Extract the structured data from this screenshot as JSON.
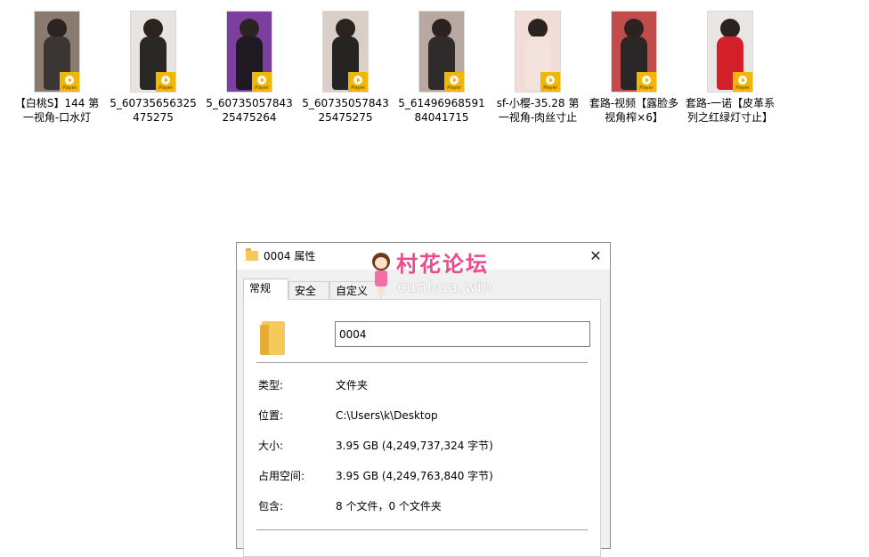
{
  "files": [
    {
      "name": "【白桃S】144 第一视角-口水灯",
      "badge": "Player"
    },
    {
      "name": "5_60735656325475275",
      "badge": "Player"
    },
    {
      "name": "5_6073505784325475264",
      "badge": "Player"
    },
    {
      "name": "5_6073505784325475275",
      "badge": "Player"
    },
    {
      "name": "5_6149696859184041715",
      "badge": "Player"
    },
    {
      "name": "sf-小樱-35.28 第一视角-肉丝寸止",
      "badge": "Player"
    },
    {
      "name": "套路-视频【露脸多视角榨×6】",
      "badge": "Player"
    },
    {
      "name": "套路-一诺【皮革系列之红绿灯寸止】",
      "badge": "Player"
    }
  ],
  "dialog": {
    "title": "0004 属性",
    "close": "✕",
    "tabs": [
      "常规",
      "安全",
      "自定义"
    ],
    "name_value": "0004",
    "props": [
      {
        "label": "类型:",
        "value": "文件夹"
      },
      {
        "label": "位置:",
        "value": "C:\\Users\\k\\Desktop"
      },
      {
        "label": "大小:",
        "value": "3.95 GB (4,249,737,324 字节)"
      },
      {
        "label": "占用空间:",
        "value": "3.95 GB (4,249,763,840 字节)"
      },
      {
        "label": "包含:",
        "value": "8 个文件，0 个文件夹"
      }
    ]
  },
  "watermark": {
    "title": "村花论坛",
    "subtitle": "cunhua.win"
  }
}
